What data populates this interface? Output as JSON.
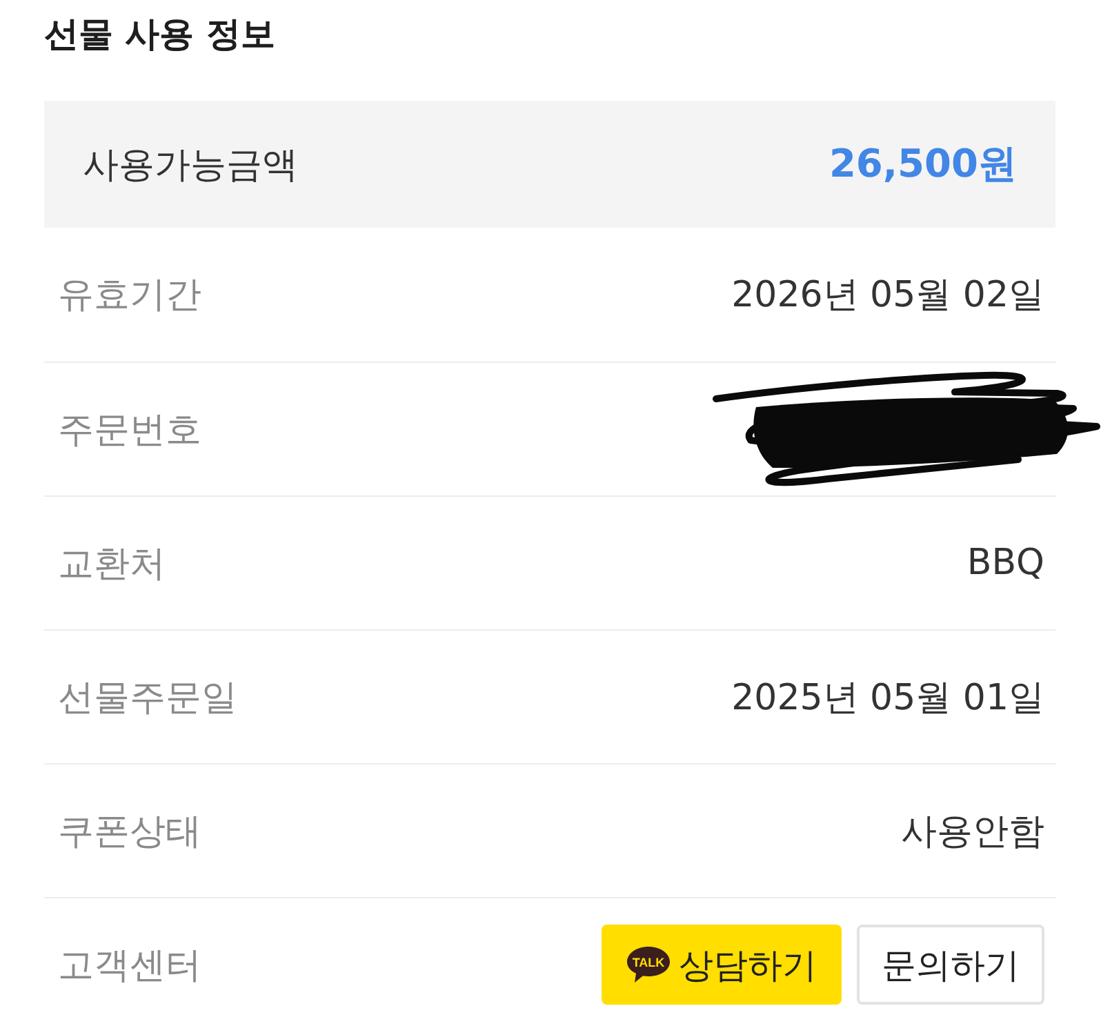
{
  "title": "선물 사용 정보",
  "amount": {
    "label": "사용가능금액",
    "value": "26,500원"
  },
  "rows": [
    {
      "kind": "text",
      "label": "유효기간",
      "value": "2026년 05월 02일"
    },
    {
      "kind": "redacted",
      "label": "주문번호"
    },
    {
      "kind": "text",
      "label": "교환처",
      "value": "BBQ"
    },
    {
      "kind": "text",
      "label": "선물주문일",
      "value": "2025년 05월 01일"
    },
    {
      "kind": "text",
      "label": "쿠폰상태",
      "value": "사용안함"
    },
    {
      "kind": "buttons",
      "label": "고객센터",
      "buttons": [
        {
          "kind": "kakao",
          "icon_text": "TALK",
          "label": "상담하기"
        },
        {
          "kind": "plain",
          "label": "문의하기"
        }
      ]
    }
  ]
}
